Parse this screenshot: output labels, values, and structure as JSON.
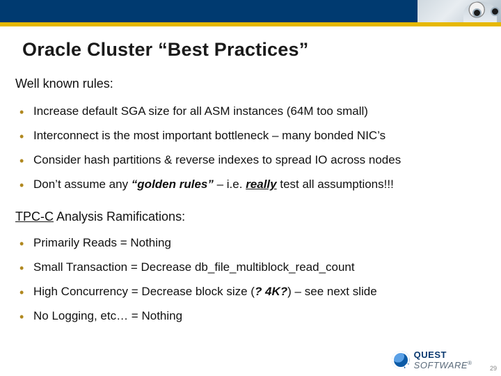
{
  "slide": {
    "title": "Oracle Cluster “Best Practices”",
    "lead": "Well known rules:",
    "bullets1": [
      {
        "text": "Increase default SGA size for all ASM instances (64M too small)"
      },
      {
        "text": "Interconnect is the most important bottleneck – many bonded NIC’s"
      },
      {
        "text": "Consider hash partitions & reverse indexes to spread IO across nodes"
      },
      {
        "pre": "Don’t assume any ",
        "em1": "“golden rules”",
        "mid": " – i.e. ",
        "em2": "really",
        "post": " test all assumptions!!!"
      }
    ],
    "sub_pre": "",
    "sub_underline": "TPC-C",
    "sub_post": " Analysis Ramifications:",
    "bullets2": [
      {
        "text": "Primarily Reads = Nothing"
      },
      {
        "text": "Small Transaction = Decrease db_file_multiblock_read_count"
      },
      {
        "pre": "High Concurrency = Decrease block size (",
        "em1": "? 4K?",
        "post": ") – see next slide"
      },
      {
        "text": "No Logging, etc… = Nothing"
      }
    ],
    "footer": {
      "brand_bold": "QUEST",
      "brand_soft": "SOFTWARE",
      "reg": "®",
      "page": "29"
    }
  }
}
